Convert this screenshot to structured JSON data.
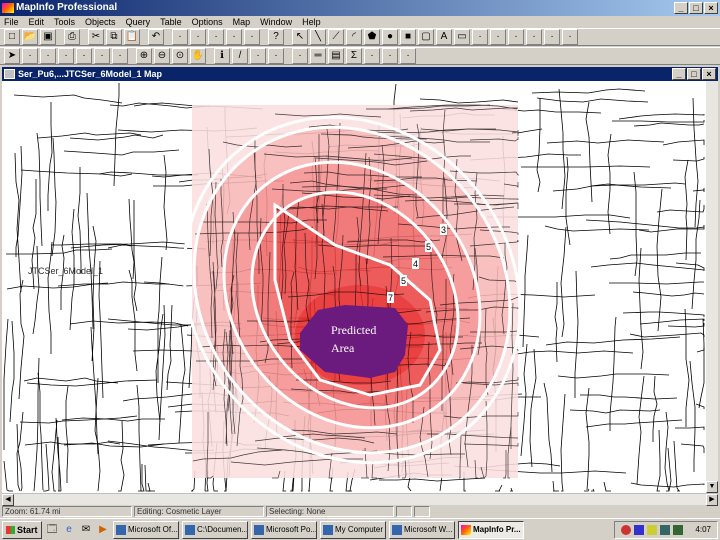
{
  "app": {
    "title": "MapInfo Professional"
  },
  "menu": [
    "File",
    "Edit",
    "Tools",
    "Objects",
    "Query",
    "Table",
    "Options",
    "Map",
    "Window",
    "Help"
  ],
  "toolbar1": [
    "new-icon",
    "open-icon",
    "save-icon",
    "print-icon",
    "cut-icon",
    "copy-icon",
    "paste-icon",
    "undo-icon",
    "new-browser-icon",
    "new-mapper-icon",
    "new-grapher-icon",
    "new-layout-icon",
    "new-redistrict-icon",
    "help-icon",
    "select-icon",
    "line-icon",
    "polyline-icon",
    "arc-icon",
    "polygon-icon",
    "ellipse-icon",
    "rectangle-icon",
    "rounded-rect-icon",
    "text-icon",
    "frame-icon",
    "reshape-icon",
    "add-node-icon",
    "symbol-style-icon",
    "line-style-icon",
    "region-style-icon",
    "text-style-icon"
  ],
  "toolbar2": [
    "select-tool-icon",
    "marquee-icon",
    "radius-icon",
    "polygon-select-icon",
    "boundary-select-icon",
    "unselect-icon",
    "invert-icon",
    "zoom-in-icon",
    "zoom-out-icon",
    "change-view-icon",
    "grabber-icon",
    "info-icon",
    "label-icon",
    "drag-window-icon",
    "hotlink-icon",
    "layer-control-icon",
    "ruler-icon",
    "legend-icon",
    "statistics-icon",
    "other-icon",
    "other2-icon",
    "other3-icon"
  ],
  "document": {
    "title": "Ser_Pu6,...JTCSer_6Model_1 Map"
  },
  "map": {
    "layer_label": "JTCSer_6Model_1",
    "predicted_area_label": [
      "Predicted",
      "Area"
    ],
    "contour_labels": [
      "3",
      "5",
      "4",
      "5",
      "7"
    ],
    "colors": {
      "outer": "#fce0e0",
      "l1": "#f9b8b8",
      "l2": "#f59090",
      "l3": "#f06868",
      "l4": "#ec4545",
      "l5": "#e82828",
      "predicted": "#6b1a7e"
    }
  },
  "status": {
    "zoom": "Zoom: 61.74 mi",
    "editing": "Editing: Cosmetic Layer",
    "selecting": "Selecting: None"
  },
  "taskbar": {
    "start": "Start",
    "tasks": [
      "Microsoft Of...",
      "C:\\Documen...",
      "Microsoft Po...",
      "My Computer",
      "Microsoft W...",
      "MapInfo Pr..."
    ],
    "clock": "4:07"
  }
}
